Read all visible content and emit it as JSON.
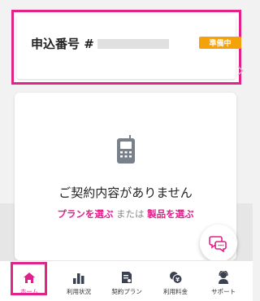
{
  "order": {
    "title": "申込番号 #",
    "status": "準備中"
  },
  "empty_state": {
    "message": "ご契約内容がありません",
    "choose_plan": "プランを選ぶ",
    "or": " または ",
    "choose_product": "製品を選ぶ"
  },
  "nav": {
    "items": [
      {
        "label": "ホーム",
        "icon": "home-icon",
        "active": true
      },
      {
        "label": "利用状況",
        "icon": "bar-chart-icon"
      },
      {
        "label": "契約プラン",
        "icon": "contract-icon"
      },
      {
        "label": "利用料金",
        "icon": "yen-icon"
      },
      {
        "label": "サポート",
        "icon": "support-icon"
      }
    ]
  },
  "colors": {
    "accent": "#e0208a",
    "status": "#f5a10a"
  }
}
